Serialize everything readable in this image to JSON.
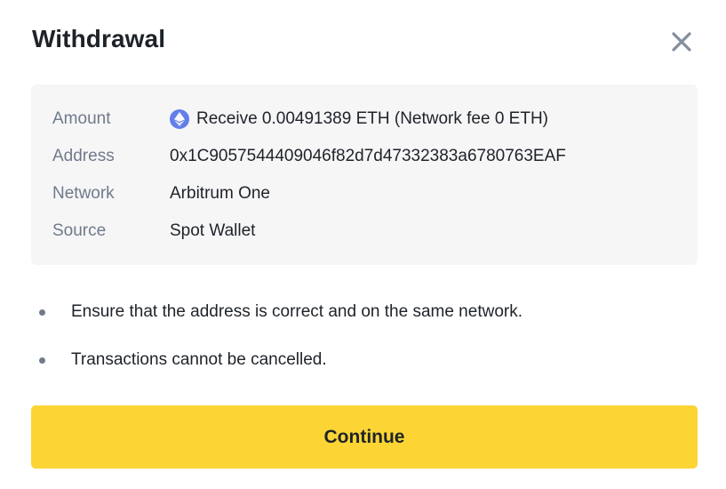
{
  "dialog": {
    "title": "Withdrawal",
    "close_icon": "close-icon"
  },
  "details": {
    "rows": [
      {
        "label": "Amount",
        "value": "Receive 0.00491389 ETH (Network fee 0 ETH)",
        "icon": "ethereum-icon"
      },
      {
        "label": "Address",
        "value": "0x1C9057544409046f82d7d47332383a6780763EAF"
      },
      {
        "label": "Network",
        "value": "Arbitrum One"
      },
      {
        "label": "Source",
        "value": "Spot Wallet"
      }
    ]
  },
  "notes": [
    "Ensure that the address is correct and on the same network.",
    "Transactions cannot be cancelled."
  ],
  "actions": {
    "continue_label": "Continue"
  },
  "colors": {
    "accent": "#fcd535",
    "panel": "#f6f6f7",
    "label": "#707a8a",
    "text": "#1e2329",
    "eth": "#627eea"
  }
}
